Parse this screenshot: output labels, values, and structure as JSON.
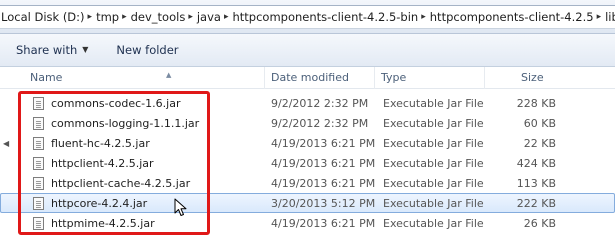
{
  "addressbar": {
    "crumbs": [
      "Local Disk (D:)",
      "tmp",
      "dev_tools",
      "java",
      "httpcomponents-client-4.2.5-bin",
      "httpcomponents-client-4.2.5",
      "lib"
    ]
  },
  "toolbar": {
    "share_label": "Share with",
    "new_folder_label": "New folder"
  },
  "columns": {
    "name": "Name",
    "date": "Date modified",
    "type": "Type",
    "size": "Size"
  },
  "files": [
    {
      "name": "commons-codec-1.6.jar",
      "date": "9/2/2012 2:32 PM",
      "type": "Executable Jar File",
      "size": "228 KB"
    },
    {
      "name": "commons-logging-1.1.1.jar",
      "date": "9/2/2012 2:32 PM",
      "type": "Executable Jar File",
      "size": "60 KB"
    },
    {
      "name": "fluent-hc-4.2.5.jar",
      "date": "4/19/2013 6:21 PM",
      "type": "Executable Jar File",
      "size": "22 KB"
    },
    {
      "name": "httpclient-4.2.5.jar",
      "date": "4/19/2013 6:21 PM",
      "type": "Executable Jar File",
      "size": "424 KB"
    },
    {
      "name": "httpclient-cache-4.2.5.jar",
      "date": "4/19/2013 6:21 PM",
      "type": "Executable Jar File",
      "size": "113 KB"
    },
    {
      "name": "httpcore-4.2.4.jar",
      "date": "3/20/2013 5:12 PM",
      "type": "Executable Jar File",
      "size": "222 KB"
    },
    {
      "name": "httpmime-4.2.5.jar",
      "date": "4/19/2013 6:21 PM",
      "type": "Executable Jar File",
      "size": "26 KB"
    }
  ],
  "selected_file": "httpcore-4.2.4.jar",
  "icons": {
    "file": "jar-file-icon",
    "cursor": "mouse-cursor-icon"
  },
  "colors": {
    "highlight_border": "#e01818",
    "selection": "#d9e9fc"
  }
}
